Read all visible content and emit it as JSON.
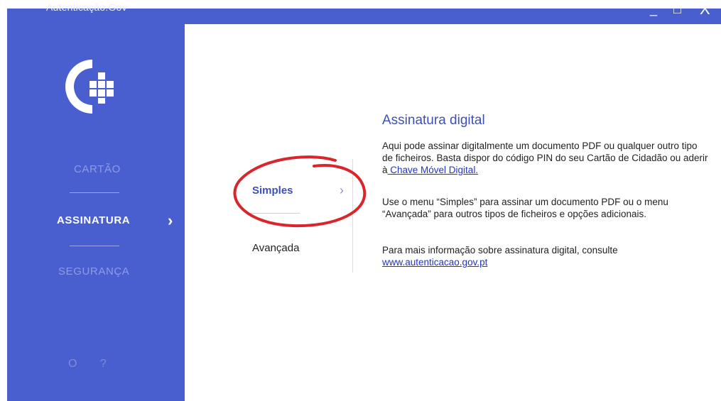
{
  "window": {
    "title": "Autenticação.Gov",
    "controls": {
      "minimize": "_",
      "maximize": "□",
      "close": "X"
    }
  },
  "sidebar": {
    "logo": "autenticacao-gov-logo",
    "items": [
      {
        "label": "CARTÃO",
        "active": false
      },
      {
        "label": "ASSINATURA",
        "active": true,
        "arrow": "›"
      },
      {
        "label": "SEGURANÇA",
        "active": false
      }
    ],
    "bottom": {
      "settings": "O",
      "help": "?"
    }
  },
  "submenu": {
    "items": [
      {
        "label": "Simples",
        "active": true,
        "arrow": "›"
      },
      {
        "label": "Avançada",
        "active": false
      }
    ],
    "highlight_color": "#d9252b"
  },
  "content": {
    "title": "Assinatura digital",
    "p1_text": "Aqui pode assinar digitalmente um documento PDF ou qualquer outro tipo de ficheiros. Basta dispor do código PIN do seu Cartão de Cidadão ou aderir à",
    "p1_link": " Chave Móvel Digital.",
    "p2_text": "Use o menu “Simples” para assinar um documento PDF ou o menu “Avançada” para outros tipos de ficheiros e opções adicionais.",
    "p3_text": "Para mais informação sobre assinatura digital, consulte",
    "p3_link": "www.autenticacao.gov.pt"
  },
  "colors": {
    "sidebar_bg": "#4a5fcf",
    "accent_text": "#3d50b8",
    "link": "#2233cc"
  }
}
